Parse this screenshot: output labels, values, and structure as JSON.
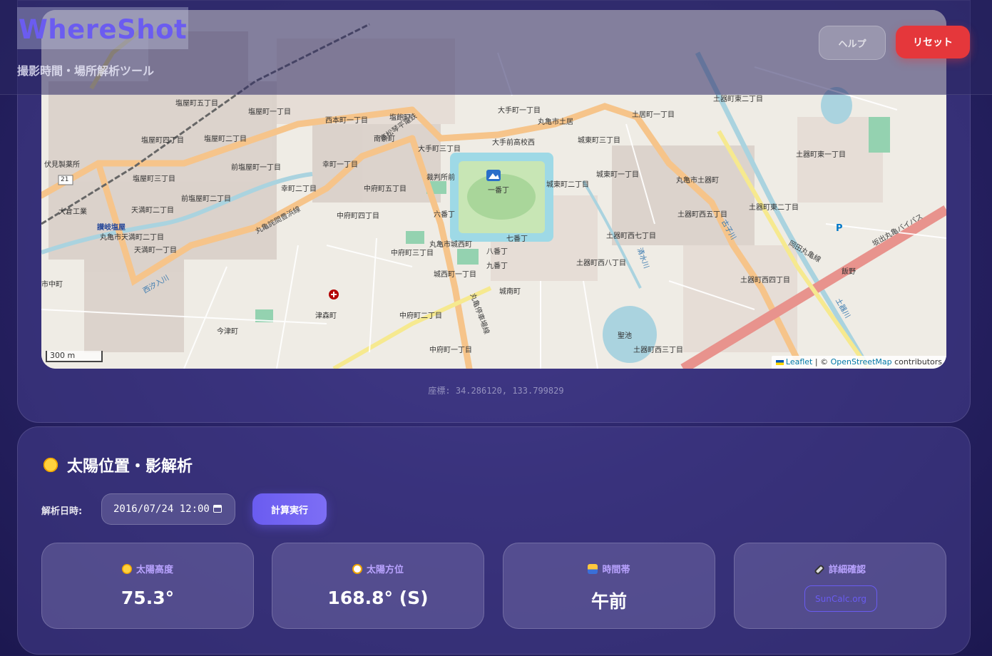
{
  "header": {
    "logo": "WhereShot",
    "subtitle": "撮影時間・場所解析ツール",
    "help_label": "ヘルプ",
    "reset_label": "リセット"
  },
  "map": {
    "labels": [
      "塩屋町五丁目",
      "塩屋町一丁目",
      "西本町一丁目",
      "塩飽町",
      "大手町一丁目",
      "丸亀市土居",
      "土居町一丁目",
      "土器町東二丁目",
      "塩屋町四丁目",
      "塩屋町二丁目",
      "南条町",
      "大手前高校西",
      "城東町三丁目",
      "土器町東一丁目",
      "伏見製薬所",
      "前塩屋町一丁目",
      "幸町一丁目",
      "大手町三丁目",
      "裁判所前",
      "一番丁",
      "城東町一丁目",
      "丸亀市土器町",
      "塩屋町三丁目",
      "幸町二丁目",
      "中府町五丁目",
      "城東町二丁目",
      "土器町西五丁目",
      "土器町東二丁目",
      "大倉工業",
      "前塩屋町二丁目",
      "天満町二丁目",
      "中府町四丁目",
      "六番丁",
      "七番丁",
      "土器町西七丁目",
      "讃岐塩屋",
      "丸亀市天満町二丁目",
      "中府町三丁目",
      "丸亀市城西町",
      "八番丁",
      "九番丁",
      "土器町西八丁目",
      "飯野",
      "天満町一丁目",
      "城西町一丁目",
      "城南町",
      "土器町西四丁目",
      "市中町",
      "津森町",
      "中府町二丁目",
      "聖池",
      "今津町",
      "中府町一丁目",
      "土器町西三丁目"
    ],
    "road_names": [
      "高松琴平電鉄",
      "丸亀詫間豊浜線",
      "坂出丸亀バイパス",
      "岡田丸亀線",
      "丸亀停車場線",
      "土器川",
      "清水川",
      "古子川",
      "西汐入川"
    ],
    "route_number": "21",
    "scale": "300 m",
    "attribution": {
      "leaflet": "Leaflet",
      "sep": " | © ",
      "osm": "OpenStreetMap",
      "suffix": " contributors"
    }
  },
  "coords": "座標: 34.286120, 133.799829",
  "sun": {
    "title": "太陽位置・影解析",
    "date_label": "解析日時:",
    "date_value": "2016/07/24 12:00",
    "calc_label": "計算実行",
    "stats": [
      {
        "icon": "sun-icon",
        "label": "太陽高度",
        "value": "75.3°"
      },
      {
        "icon": "compass-icon",
        "label": "太陽方位",
        "value": "168.8° (S)"
      },
      {
        "icon": "sunrise-icon",
        "label": "時間帯",
        "value": "午前"
      },
      {
        "icon": "link-icon",
        "label": "詳細確認",
        "link": "SunCalc.org"
      }
    ]
  },
  "colors": {
    "accent": "#6a5cf0",
    "reset": "#e5373b",
    "stat_label": "#b9a3ff"
  }
}
